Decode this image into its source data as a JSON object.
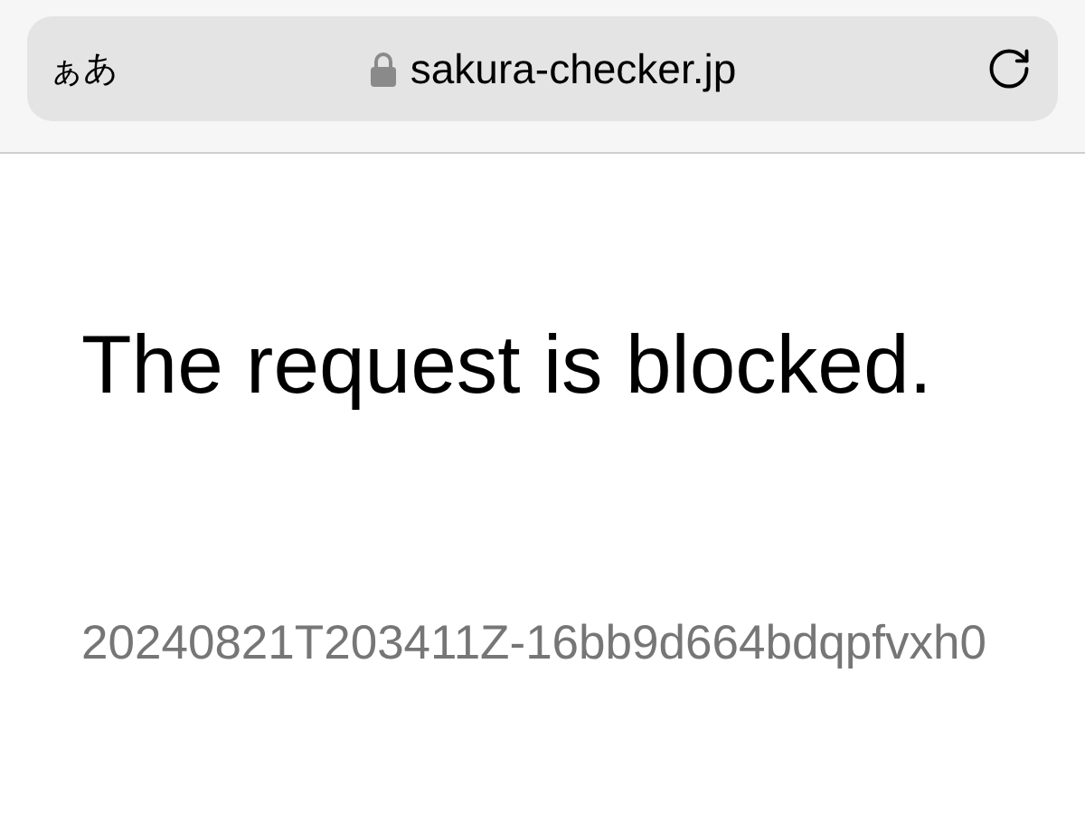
{
  "address_bar": {
    "text_size_button": "ぁあ",
    "secure": true,
    "url": "sakura-checker.jp"
  },
  "page": {
    "heading": "The request is blocked.",
    "request_id": "20240821T203411Z-16bb9d664bdqpfvxh0"
  }
}
